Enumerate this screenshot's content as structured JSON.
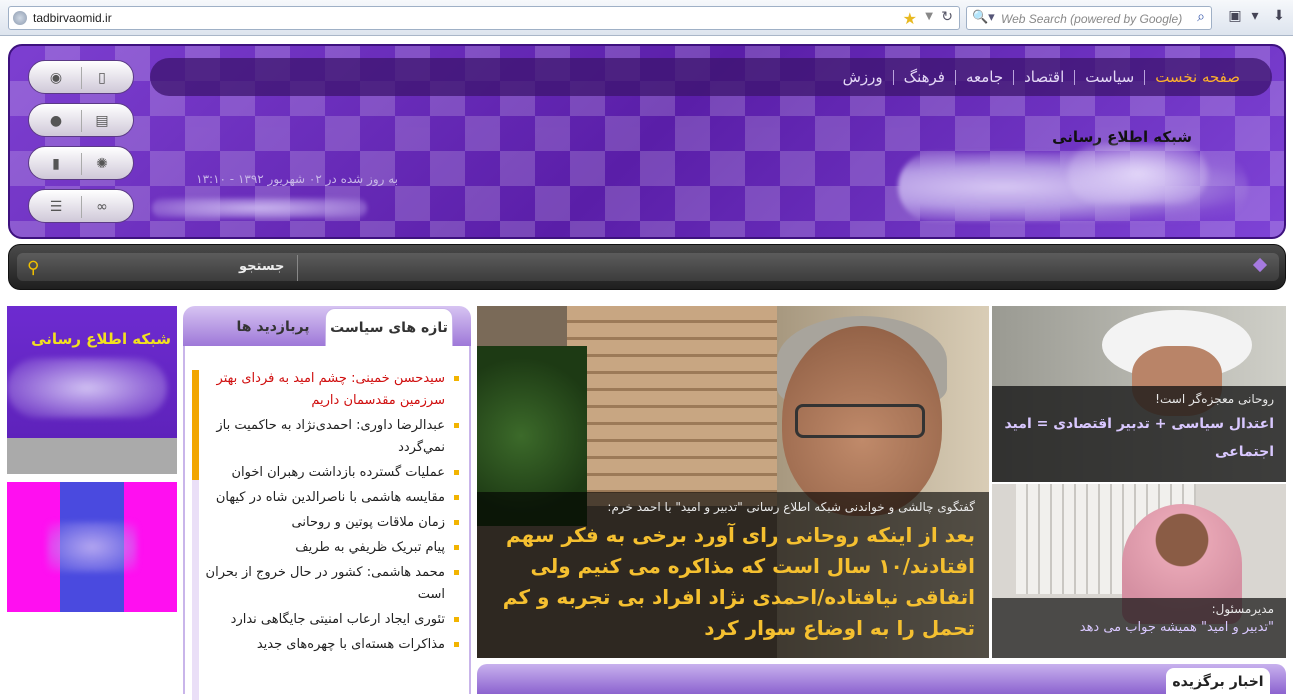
{
  "browser": {
    "url": "tadbirvaomid.ir",
    "search_placeholder": "Web Search (powered by Google)"
  },
  "header": {
    "nav": [
      "صفحه نخست",
      "سیاست",
      "اقتصاد",
      "جامعه",
      "فرهنگ",
      "ورزش"
    ],
    "network_name": "شبکه اطلاع رسانی",
    "updated": "به روز شده در ۰۲ شهریور ۱۳۹۲ - ۱۳:۱۰"
  },
  "search": {
    "label": "جستجو"
  },
  "ads": {
    "ad1_title": "شبکه اطلاع رسانی"
  },
  "tabs": {
    "active": "تازه های سیاست",
    "other": "پربازدید ها"
  },
  "news": [
    "سیدحسن خمینی: چشم امید به فردای بهتر سرزمین مقدسمان داریم",
    "عبدالرضا داوری: احمدی‌نژاد به حاکمیت باز نمي‌گردد",
    "عملیات گسترده بازداشت رهبران اخوان",
    "مقایسه هاشمی با ناصرالدین شاه در کیهان",
    "زمان ملاقات پوتین و روحانی",
    "پیام تبریک ظریفي به طریف",
    "محمد هاشمی: کشور در حال خروج از بحران است",
    "تئوری ایجاد ارعاب امنیتی جایگاهی ندارد",
    "مذاکرات هسته‌ای با چهره‌های جدید"
  ],
  "feature": {
    "kicker": "گفتگوی چالشی و خواندنی شبکه اطلاع رسانی \"تدبیر و امید\" با احمد خرم:",
    "headline": "بعد از اینکه روحانی رای آورد برخی به فکر سهم افتادند/۱۰ سال است که مذاکره می کنیم ولی اتفاقی نیافتاده/احمدی نژاد افراد بی تجربه و کم تحمل را به اوضاع سوار کرد"
  },
  "side_stories": [
    {
      "kicker": "روحانی معجزه‌گر است!",
      "title": "اعتدال سیاسی + تدبیر اقتصادی = امید اجتماعی"
    },
    {
      "kicker": "مدیرمسئول:",
      "title": "\"تدبیر و امید\" همیشه جواب می دهد"
    }
  ],
  "selected": {
    "label": "اخبار برگزیده"
  },
  "colors": {
    "header_purple": "#6a2dc0",
    "accent_orange": "#ffb22b",
    "headline_gold": "#f5c030"
  }
}
